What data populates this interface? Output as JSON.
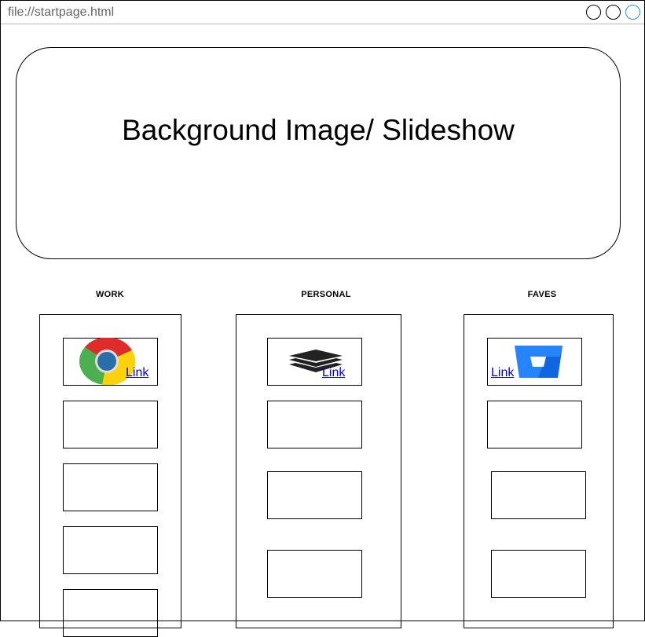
{
  "browser": {
    "url": "file://startpage.html",
    "window_controls": [
      "minimize",
      "maximize",
      "close"
    ],
    "close_color": "#1e90ff"
  },
  "banner": {
    "text": "Background Image/ Slideshow"
  },
  "columns": [
    {
      "title": "WORK",
      "first_link": {
        "label": "Link",
        "icon": "chrome-icon"
      }
    },
    {
      "title": "PERSONAL",
      "first_link": {
        "label": "Link",
        "icon": "layers-icon"
      }
    },
    {
      "title": "FAVES",
      "first_link": {
        "label": "Link",
        "icon": "bitbucket-icon"
      }
    }
  ]
}
